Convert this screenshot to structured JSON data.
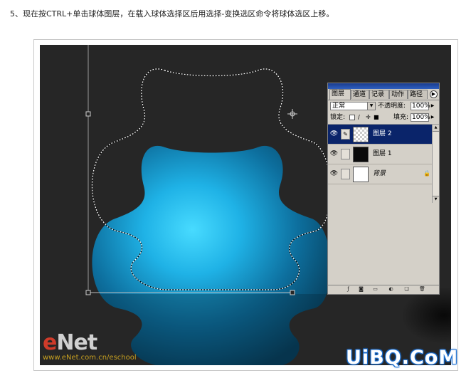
{
  "instruction": "5、现在按CTRL+单击球体图层，在载入球体选择区后用选择-变换选区命令将球体选区上移。",
  "panel": {
    "tabs": [
      "图层",
      "通道",
      "记录",
      "动作",
      "路径"
    ],
    "blend_mode": "正常",
    "opacity_label": "不透明度:",
    "opacity_value": "100%",
    "lock_label": "锁定:",
    "fill_label": "填充:",
    "fill_value": "100%",
    "layers": [
      {
        "name": "图层 2",
        "selected": true,
        "thumb": "transparent"
      },
      {
        "name": "图层 1",
        "selected": false,
        "thumb": "black"
      },
      {
        "name": "背景",
        "selected": false,
        "thumb": "white",
        "locked": true
      }
    ],
    "icons": {
      "menu": "panel-menu-icon",
      "eye": "eye-icon",
      "brush": "brush-link-icon",
      "padlock": "padlock-icon",
      "bottom": [
        "layer-style-icon",
        "mask-icon",
        "new-set-icon",
        "adjustment-layer-icon",
        "new-layer-icon",
        "trash-icon"
      ]
    }
  },
  "watermarks": {
    "enet_e": "e",
    "enet_rest": "Net",
    "enet_url": "www.eNet.com.cn/eschool",
    "uibq": "UiBQ.CoM"
  },
  "colors": {
    "canvas": "#262626",
    "sphere_light": "#3fd3ff",
    "sphere_dark": "#0a3d5c",
    "selection_highlight": "#0a246a",
    "uibq_outline": "#1c6fd1"
  }
}
